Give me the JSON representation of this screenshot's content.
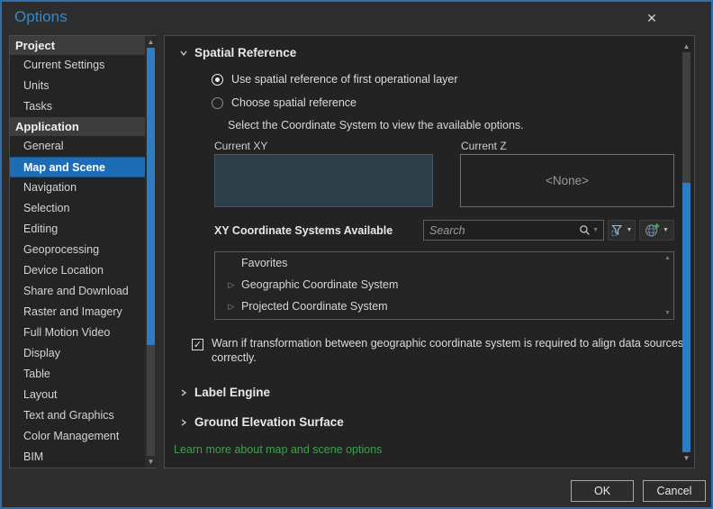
{
  "window": {
    "title": "Options",
    "accent_color": "#2f8ad2",
    "border_color": "#2f6fae",
    "selection_color": "#1e6cb5",
    "scrollbar_thumb_color": "#2e7dc2"
  },
  "icons": {
    "close": "✕",
    "scroll_up": "▲",
    "scroll_down": "▼",
    "dropdown_caret": "▼",
    "expander_collapsed": "▷",
    "checkmark": "✓"
  },
  "sidebar": {
    "sections": [
      {
        "header": "Project",
        "items": [
          {
            "label": "Current Settings"
          },
          {
            "label": "Units"
          },
          {
            "label": "Tasks"
          }
        ]
      },
      {
        "header": "Application",
        "items": [
          {
            "label": "General"
          },
          {
            "label": "Map and Scene",
            "selected": true
          },
          {
            "label": "Navigation"
          },
          {
            "label": "Selection"
          },
          {
            "label": "Editing"
          },
          {
            "label": "Geoprocessing"
          },
          {
            "label": "Device Location"
          },
          {
            "label": "Share and Download"
          },
          {
            "label": "Raster and Imagery"
          },
          {
            "label": "Full Motion Video"
          },
          {
            "label": "Display"
          },
          {
            "label": "Table"
          },
          {
            "label": "Layout"
          },
          {
            "label": "Text and Graphics"
          },
          {
            "label": "Color Management"
          },
          {
            "label": "BIM"
          }
        ]
      }
    ]
  },
  "main": {
    "spatial_reference": {
      "title": "Spatial Reference",
      "radio_use_first_label": "Use spatial reference of first operational layer",
      "radio_use_first_selected": true,
      "radio_choose_label": "Choose spatial reference",
      "radio_choose_selected": false,
      "helper_text": "Select the Coordinate System to view the available options.",
      "current_xy_label": "Current XY",
      "current_z_label": "Current Z",
      "current_z_value": "<None>",
      "xy_available_label": "XY Coordinate Systems Available",
      "search_placeholder": "Search",
      "list_items": [
        {
          "label": "Favorites",
          "expandable": false
        },
        {
          "label": "Geographic Coordinate System",
          "expandable": true
        },
        {
          "label": "Projected Coordinate System",
          "expandable": true
        }
      ],
      "warn_checkbox_checked": true,
      "warn_checkbox_label": "Warn if transformation between geographic coordinate system is required to align data sources correctly."
    },
    "collapsed_sections": [
      {
        "title": "Label Engine"
      },
      {
        "title": "Ground Elevation Surface"
      }
    ],
    "learn_more_link": "Learn more about map and scene options"
  },
  "footer": {
    "ok_label": "OK",
    "cancel_label": "Cancel"
  }
}
